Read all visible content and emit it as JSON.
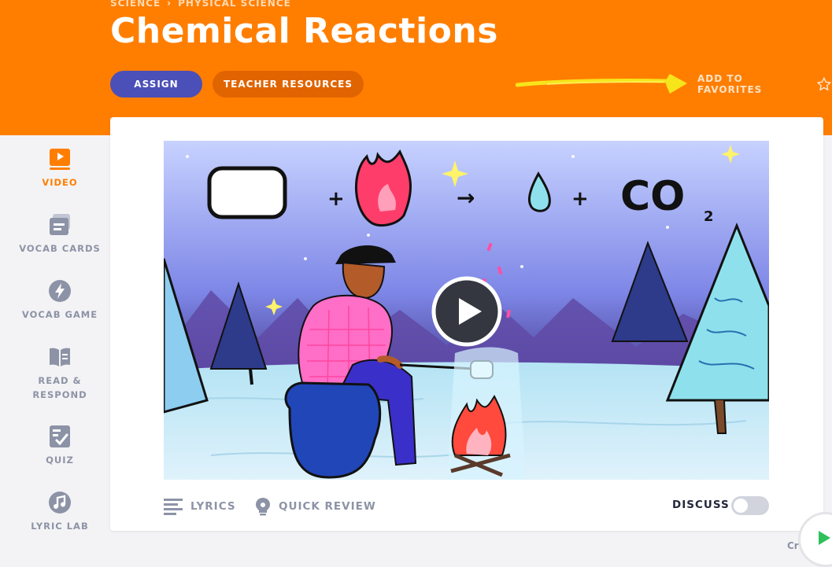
{
  "breadcrumb": {
    "items": [
      "SCIENCE",
      "PHYSICAL SCIENCE"
    ],
    "separator": "›"
  },
  "page": {
    "title": "Chemical Reactions"
  },
  "actions": {
    "assign_label": "ASSIGN",
    "resources_label": "TEACHER RESOURCES",
    "favorites_label": "ADD TO FAVORITES"
  },
  "sidebar": {
    "items": [
      {
        "label": "VIDEO",
        "icon": "video-icon",
        "active": true
      },
      {
        "label": "VOCAB CARDS",
        "icon": "vocab-cards-icon",
        "active": false
      },
      {
        "label": "VOCAB GAME",
        "icon": "lightning-icon",
        "active": false
      },
      {
        "label": "READ &",
        "label2": "RESPOND",
        "icon": "book-icon",
        "active": false
      },
      {
        "label": "QUIZ",
        "icon": "quiz-check-icon",
        "active": false
      },
      {
        "label": "LYRIC LAB",
        "icon": "music-note-icon",
        "active": false
      }
    ]
  },
  "video": {
    "formula": {
      "plus1": "+",
      "plus2": "+",
      "arrow": "→",
      "co": "CO",
      "sub": "2"
    }
  },
  "tools": {
    "lyrics_label": "LYRICS",
    "quick_review_label": "QUICK REVIEW",
    "discuss_label": "DISCUSS",
    "discuss_on": false
  },
  "footer": {
    "credits_label": "Cre"
  },
  "colors": {
    "brand_orange": "#ff7e00",
    "assign_blue": "#4b4fb8",
    "resources_orange": "#e06400",
    "active": "#ff7e00",
    "muted": "#8d93a6",
    "play_green": "#2ec15a"
  }
}
